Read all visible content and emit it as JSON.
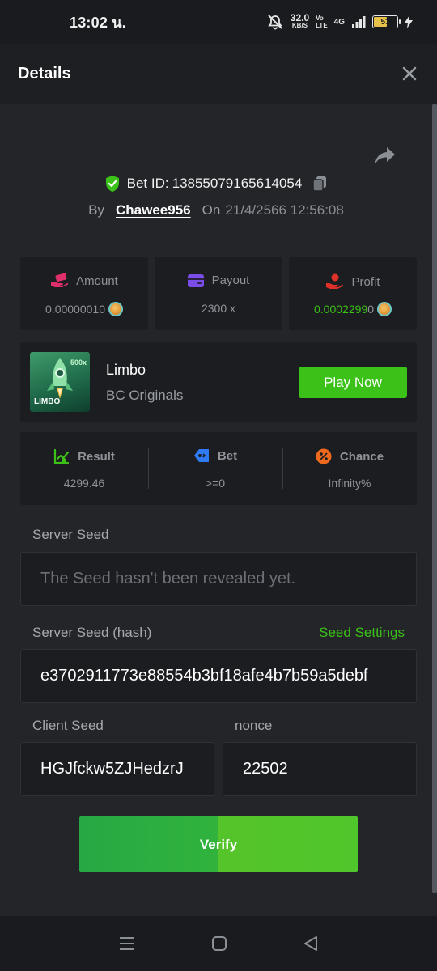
{
  "status_bar": {
    "time": "13:02 น.",
    "net_speed": "32.0",
    "net_unit": "KB/S",
    "volte_top": "Vo",
    "volte_bottom": "LTE",
    "net_type": "4G",
    "battery_level": "53",
    "battery_fraction": 0.53
  },
  "header": {
    "title": "Details"
  },
  "bet": {
    "id_label": "Bet ID:",
    "id": "13855079165614054",
    "by_label": "By",
    "user": "Chawee956",
    "on_label": "On",
    "date": "21/4/2566 12:56:08"
  },
  "stats": {
    "amount": {
      "label": "Amount",
      "value": "0.00000010"
    },
    "payout": {
      "label": "Payout",
      "value": "2300 x"
    },
    "profit": {
      "label": "Profit",
      "value_main": "0.0002299",
      "value_tail": "0"
    }
  },
  "game": {
    "name": "Limbo",
    "subtitle": "BC Originals",
    "play_label": "Play Now",
    "thumb_text": "LIMBO",
    "thumb_badge": "500x"
  },
  "results": {
    "result": {
      "label": "Result",
      "value": "4299.46"
    },
    "bet": {
      "label": "Bet",
      "value": ">=0"
    },
    "chance": {
      "label": "Chance",
      "value": "Infinity%"
    }
  },
  "seeds": {
    "server_seed_label": "Server Seed",
    "server_seed_placeholder": "The Seed hasn't been revealed yet.",
    "server_hash_label": "Server Seed (hash)",
    "seed_settings_label": "Seed Settings",
    "server_hash_value": "e3702911773e88554b3bf18afe4b7b59a5debf",
    "client_seed_label": "Client Seed",
    "client_seed_value": "HGJfckw5ZJHedzrJ",
    "nonce_label": "nonce",
    "nonce_value": "22502"
  },
  "verify_label": "Verify",
  "colors": {
    "accent_green": "#3bc117",
    "background": "#232529",
    "card": "#1c1d20",
    "amount_icon": "#e0306b",
    "payout_icon": "#7b4de8",
    "profit_icon": "#e0302a",
    "result_icon": "#3bc117",
    "bet_icon": "#2f7bf5",
    "chance_icon": "#f06a1d"
  },
  "icons": {
    "close": "close-icon",
    "share": "share-icon",
    "shield": "shield-check-icon",
    "copy": "copy-icon",
    "amount": "hand-money-icon",
    "payout": "wallet-icon",
    "profit": "hand-coin-icon",
    "result": "trend-chart-icon",
    "bet": "tag-icon",
    "chance": "percent-icon",
    "coin": "coin-icon"
  }
}
